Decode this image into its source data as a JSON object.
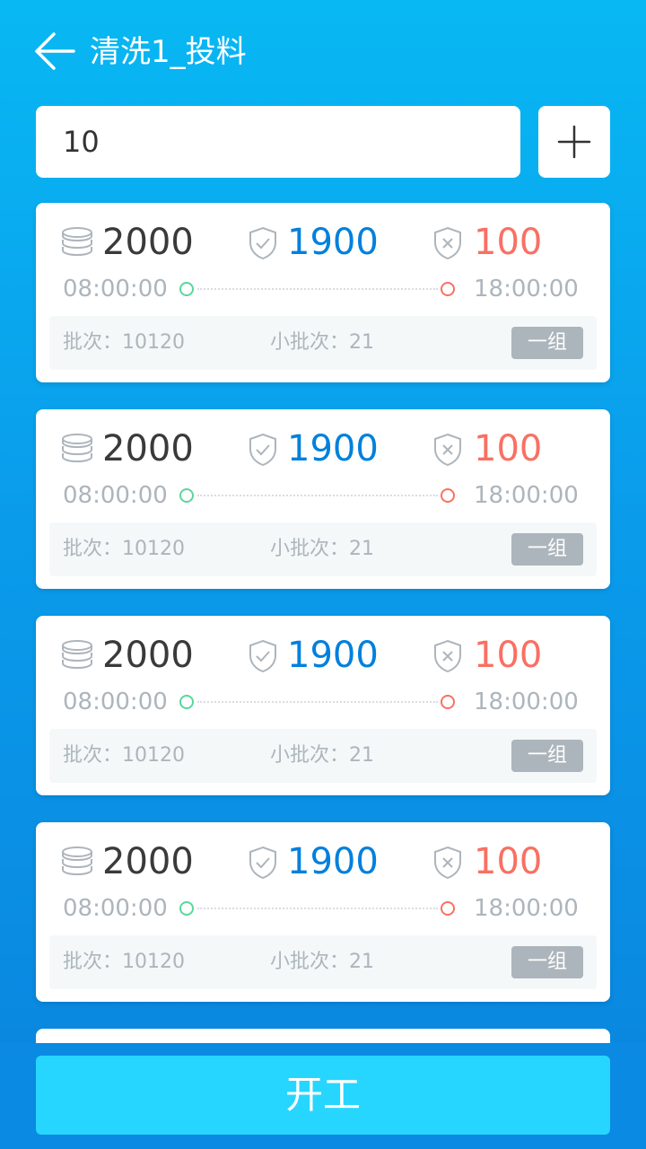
{
  "header": {
    "title": "清洗1_投料"
  },
  "input": {
    "value": "10"
  },
  "colors": {
    "ok_number": "#0080dc",
    "ng_number": "#f97062",
    "muted_text": "#adb5bc",
    "batch_bg": "#f4f8f9",
    "start_button": "#27d6ff"
  },
  "cards": [
    {
      "total": "2000",
      "ok": "1900",
      "ng": "100",
      "start_time": "08:00:00",
      "end_time": "18:00:00",
      "batch": "批次：10120",
      "sub_batch": "小批次：21",
      "group": "一组"
    },
    {
      "total": "2000",
      "ok": "1900",
      "ng": "100",
      "start_time": "08:00:00",
      "end_time": "18:00:00",
      "batch": "批次：10120",
      "sub_batch": "小批次：21",
      "group": "一组"
    },
    {
      "total": "2000",
      "ok": "1900",
      "ng": "100",
      "start_time": "08:00:00",
      "end_time": "18:00:00",
      "batch": "批次：10120",
      "sub_batch": "小批次：21",
      "group": "一组"
    },
    {
      "total": "2000",
      "ok": "1900",
      "ng": "100",
      "start_time": "08:00:00",
      "end_time": "18:00:00",
      "batch": "批次：10120",
      "sub_batch": "小批次：21",
      "group": "一组"
    }
  ],
  "icons": {
    "back": "back-arrow-icon",
    "add": "plus-icon",
    "total": "stack-icon",
    "ok": "shield-check-icon",
    "ng": "shield-x-icon"
  },
  "bottom": {
    "start_label": "开工"
  }
}
